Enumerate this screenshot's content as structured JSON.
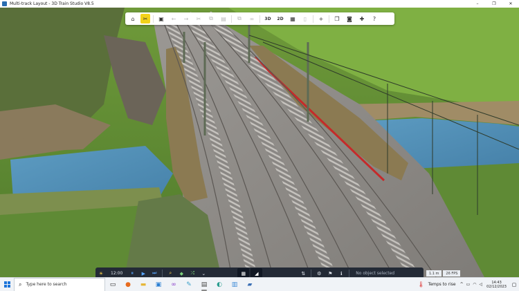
{
  "window": {
    "title": "Multi-track Layout - 3D Train Studio V8.5",
    "controls": [
      "–",
      "❐",
      "✕"
    ]
  },
  "toolbar": {
    "items": [
      {
        "icon": "home-icon",
        "glyph": "⌂"
      },
      {
        "icon": "tools-icon",
        "glyph": "✂",
        "active": true
      },
      {
        "icon": "save-icon",
        "glyph": "▣"
      },
      {
        "icon": "undo-icon",
        "glyph": "←"
      },
      {
        "icon": "redo-icon",
        "glyph": "→"
      },
      {
        "icon": "cut-icon",
        "glyph": "✂"
      },
      {
        "icon": "copy-icon",
        "glyph": "⧉"
      },
      {
        "icon": "paste-icon",
        "glyph": "▤"
      },
      {
        "icon": "duplicate-icon",
        "glyph": "⧉"
      },
      {
        "icon": "link-icon",
        "glyph": "∞"
      },
      {
        "label": "3D"
      },
      {
        "label": "2D"
      },
      {
        "icon": "grid-icon",
        "glyph": "▦"
      },
      {
        "icon": "flashlight-icon",
        "glyph": "▯"
      },
      {
        "icon": "add-icon",
        "glyph": "+"
      },
      {
        "icon": "windows-icon",
        "glyph": "❐"
      },
      {
        "icon": "camera-icon",
        "glyph": "◙"
      },
      {
        "icon": "puzzle-icon",
        "glyph": "✚"
      },
      {
        "icon": "help-icon",
        "glyph": "?"
      }
    ]
  },
  "bottombar": {
    "time": "12:00",
    "status": "No object selected"
  },
  "readout": {
    "scale": "1.1 m",
    "fps": "26 FPS"
  },
  "taskbar": {
    "search_placeholder": "Type here to search",
    "weather": "Temps to rise",
    "time": "14:43",
    "date": "02/12/2023"
  },
  "colors": {
    "accent": "#f2d21b",
    "toolbar_bg": "#ffffff",
    "bottombar_bg": "#232a36",
    "taskbar_bg": "#f0f3f7"
  }
}
